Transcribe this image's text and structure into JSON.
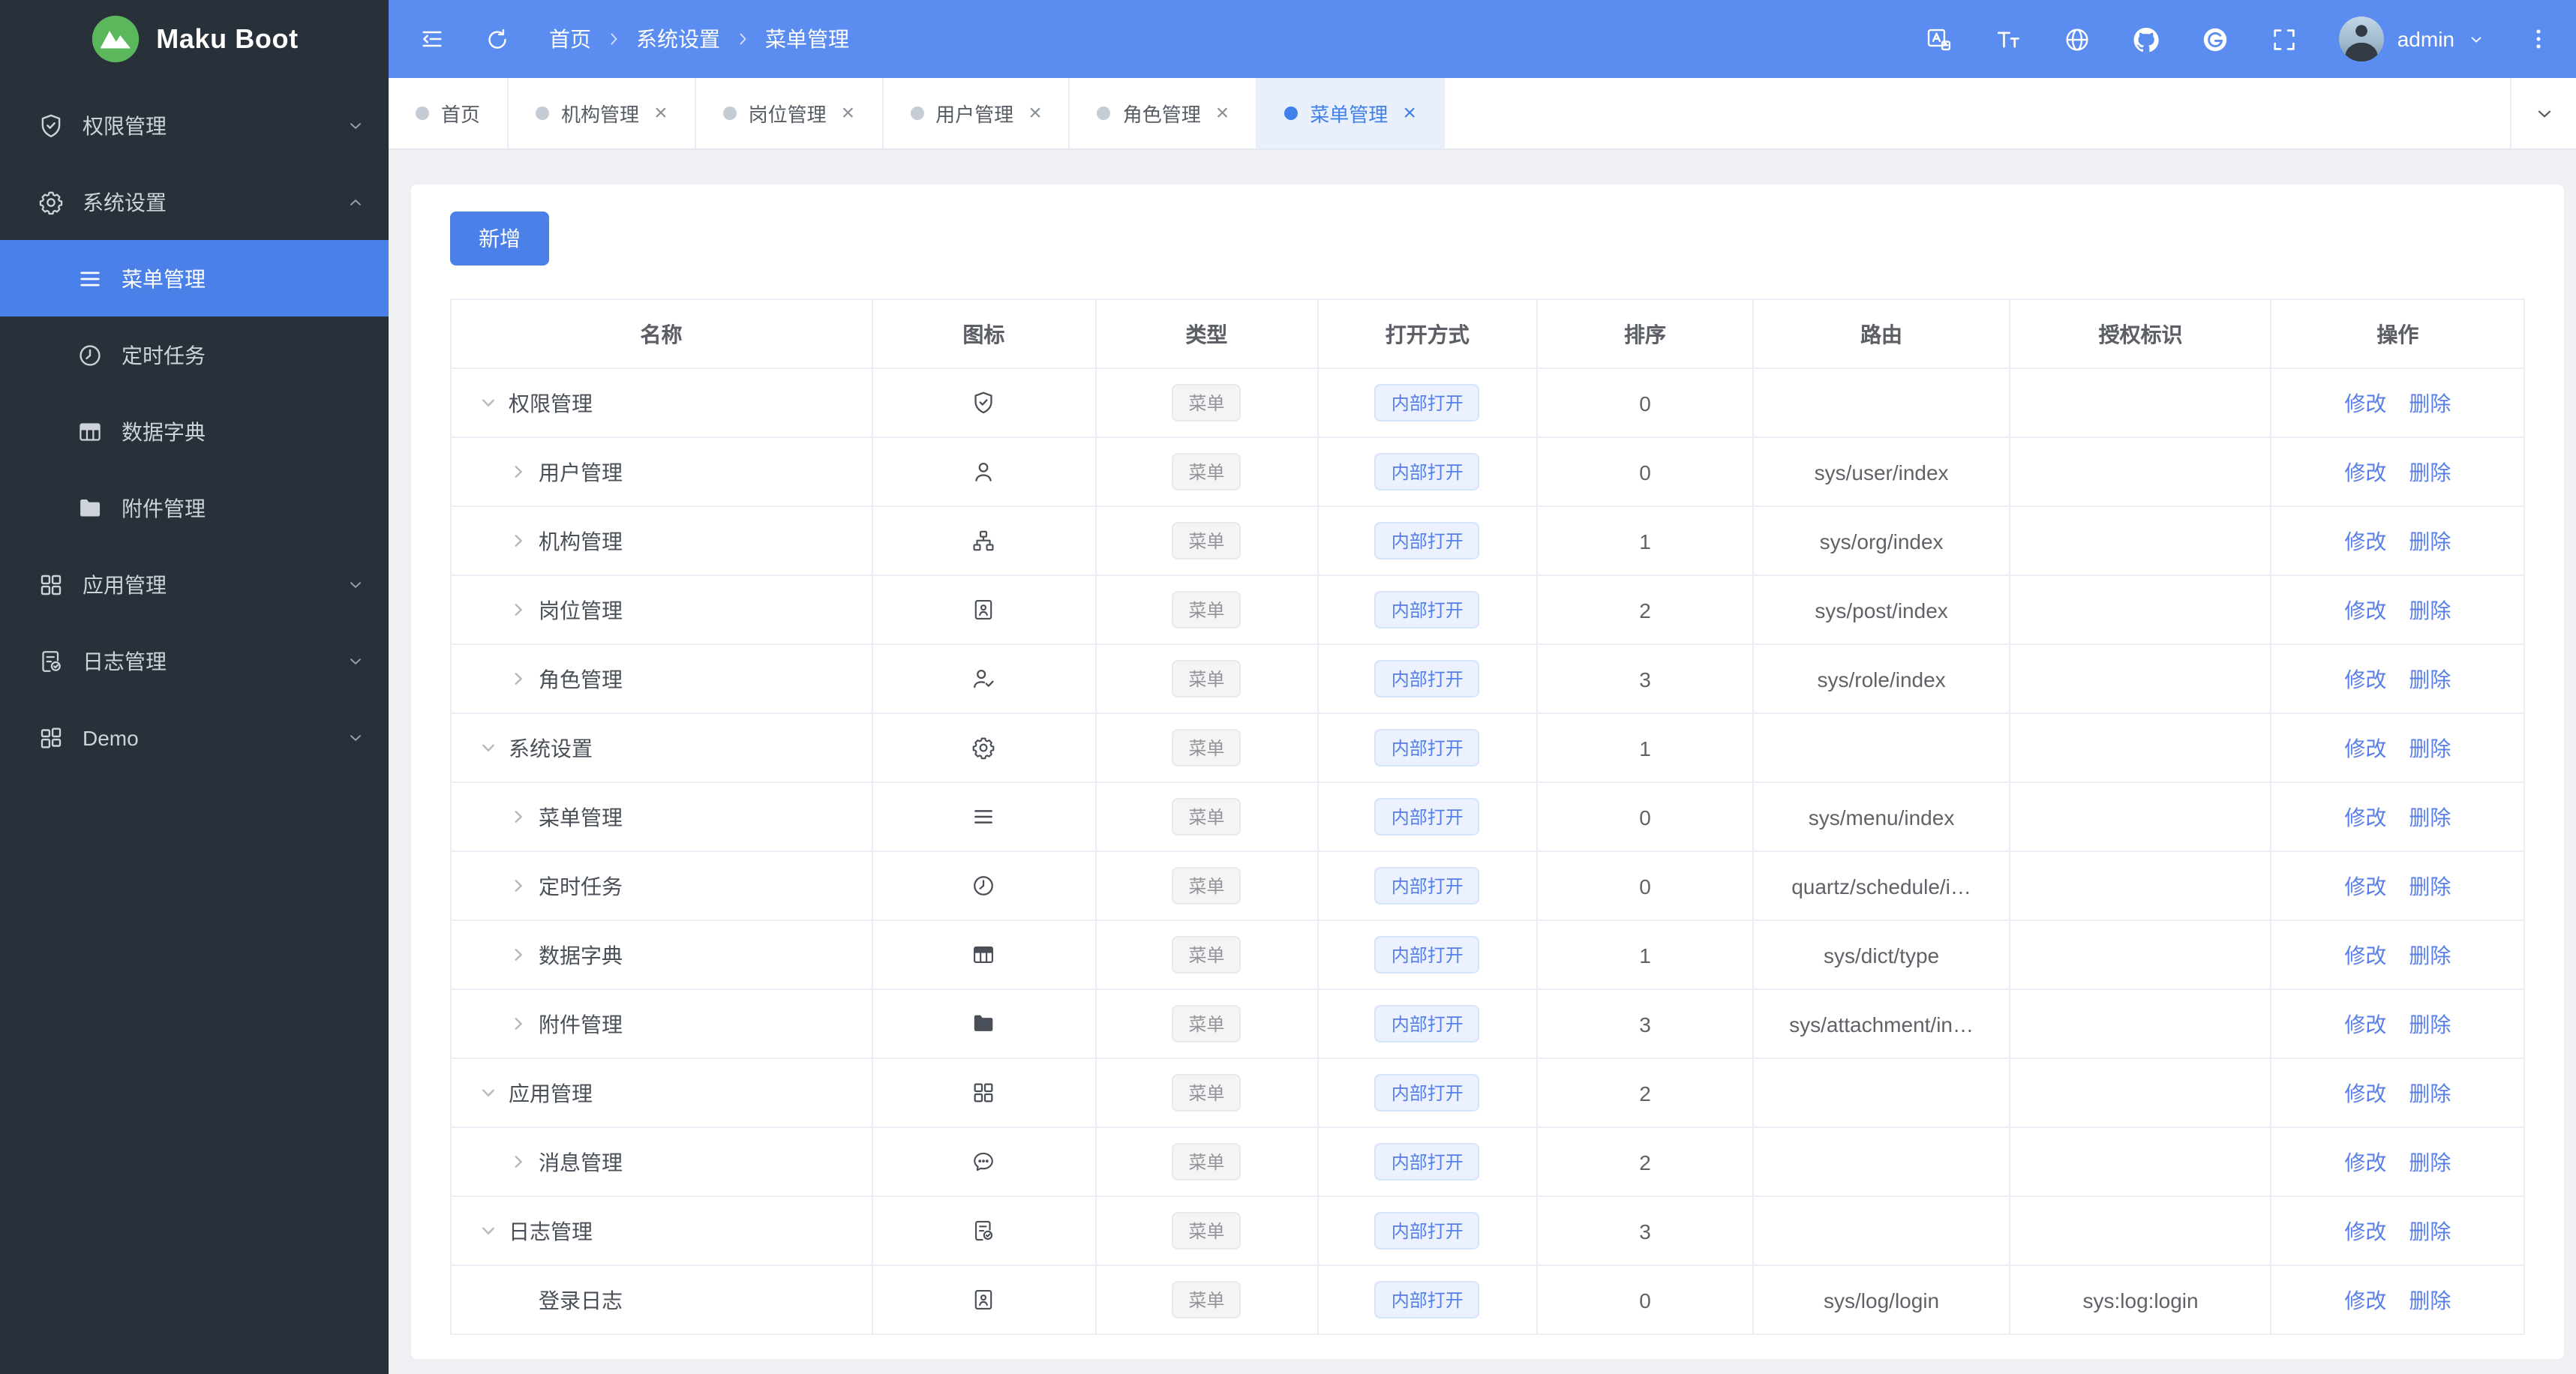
{
  "brand": {
    "name": "Maku Boot"
  },
  "header": {
    "breadcrumb": [
      "首页",
      "系统设置",
      "菜单管理"
    ],
    "tools": [
      "translate",
      "font-size",
      "globe",
      "github",
      "gitee",
      "fullscreen"
    ],
    "user": "admin",
    "more_icon": "dots-vertical"
  },
  "tabs": [
    {
      "label": "首页",
      "closable": false,
      "active": false
    },
    {
      "label": "机构管理",
      "closable": true,
      "active": false
    },
    {
      "label": "岗位管理",
      "closable": true,
      "active": false
    },
    {
      "label": "用户管理",
      "closable": true,
      "active": false
    },
    {
      "label": "角色管理",
      "closable": true,
      "active": false
    },
    {
      "label": "菜单管理",
      "closable": true,
      "active": true
    }
  ],
  "sidebar": {
    "items": [
      {
        "id": "permissions",
        "label": "权限管理",
        "icon": "shield-check",
        "expanded": false
      },
      {
        "id": "system",
        "label": "系统设置",
        "icon": "gear",
        "expanded": true,
        "children": [
          {
            "id": "menu",
            "label": "菜单管理",
            "icon": "menu-lines",
            "active": true
          },
          {
            "id": "schedule",
            "label": "定时任务",
            "icon": "clock",
            "active": false
          },
          {
            "id": "dict",
            "label": "数据字典",
            "icon": "dict-table",
            "active": false
          },
          {
            "id": "attachment",
            "label": "附件管理",
            "icon": "folder-filled",
            "active": false
          }
        ]
      },
      {
        "id": "apps",
        "label": "应用管理",
        "icon": "grid",
        "expanded": false
      },
      {
        "id": "logs",
        "label": "日志管理",
        "icon": "log-doc",
        "expanded": false
      },
      {
        "id": "demo",
        "label": "Demo",
        "icon": "grid-alt",
        "expanded": false
      }
    ]
  },
  "toolbar": {
    "add_label": "新增"
  },
  "table": {
    "columns": [
      "名称",
      "图标",
      "类型",
      "打开方式",
      "排序",
      "路由",
      "授权标识",
      "操作"
    ],
    "tags": {
      "type_label": "菜单",
      "open_label": "内部打开"
    },
    "actions": [
      "修改",
      "删除"
    ],
    "rows": [
      {
        "name": "权限管理",
        "level": 0,
        "arrow": "expanded",
        "icon": "shield-check",
        "sort": "0",
        "route": "",
        "auth": ""
      },
      {
        "name": "用户管理",
        "level": 1,
        "arrow": "collapsed",
        "icon": "user",
        "sort": "0",
        "route": "sys/user/index",
        "auth": ""
      },
      {
        "name": "机构管理",
        "level": 1,
        "arrow": "collapsed",
        "icon": "org",
        "sort": "1",
        "route": "sys/org/index",
        "auth": ""
      },
      {
        "name": "岗位管理",
        "level": 1,
        "arrow": "collapsed",
        "icon": "badge",
        "sort": "2",
        "route": "sys/post/index",
        "auth": ""
      },
      {
        "name": "角色管理",
        "level": 1,
        "arrow": "collapsed",
        "icon": "user-check",
        "sort": "3",
        "route": "sys/role/index",
        "auth": ""
      },
      {
        "name": "系统设置",
        "level": 0,
        "arrow": "expanded",
        "icon": "gear",
        "sort": "1",
        "route": "",
        "auth": ""
      },
      {
        "name": "菜单管理",
        "level": 1,
        "arrow": "collapsed",
        "icon": "menu-lines",
        "sort": "0",
        "route": "sys/menu/index",
        "auth": ""
      },
      {
        "name": "定时任务",
        "level": 1,
        "arrow": "collapsed",
        "icon": "clock",
        "sort": "0",
        "route": "quartz/schedule/i…",
        "auth": ""
      },
      {
        "name": "数据字典",
        "level": 1,
        "arrow": "collapsed",
        "icon": "dict-table",
        "sort": "1",
        "route": "sys/dict/type",
        "auth": ""
      },
      {
        "name": "附件管理",
        "level": 1,
        "arrow": "collapsed",
        "icon": "folder-filled",
        "sort": "3",
        "route": "sys/attachment/in…",
        "auth": ""
      },
      {
        "name": "应用管理",
        "level": 0,
        "arrow": "expanded",
        "icon": "grid",
        "sort": "2",
        "route": "",
        "auth": ""
      },
      {
        "name": "消息管理",
        "level": 1,
        "arrow": "collapsed",
        "icon": "message",
        "sort": "2",
        "route": "",
        "auth": ""
      },
      {
        "name": "日志管理",
        "level": 0,
        "arrow": "expanded",
        "icon": "log-doc",
        "sort": "3",
        "route": "",
        "auth": ""
      },
      {
        "name": "登录日志",
        "level": 1,
        "arrow": "none",
        "icon": "badge",
        "sort": "0",
        "route": "sys/log/login",
        "auth": "sys:log:login"
      }
    ]
  },
  "colors": {
    "header_bg": "#5b8df0",
    "sidebar_bg": "#283039",
    "accent": "#4a80e8",
    "link": "#587ee8",
    "tag_blue_bg": "#ebf2fd",
    "tag_blue_text": "#567ee8",
    "tag_gray_bg": "#f4f4f5",
    "tag_gray_text": "#909399",
    "active_tab_bg": "#e9f0fb",
    "logo_green": "#5bb75b",
    "content_bg": "#eef0f4"
  }
}
